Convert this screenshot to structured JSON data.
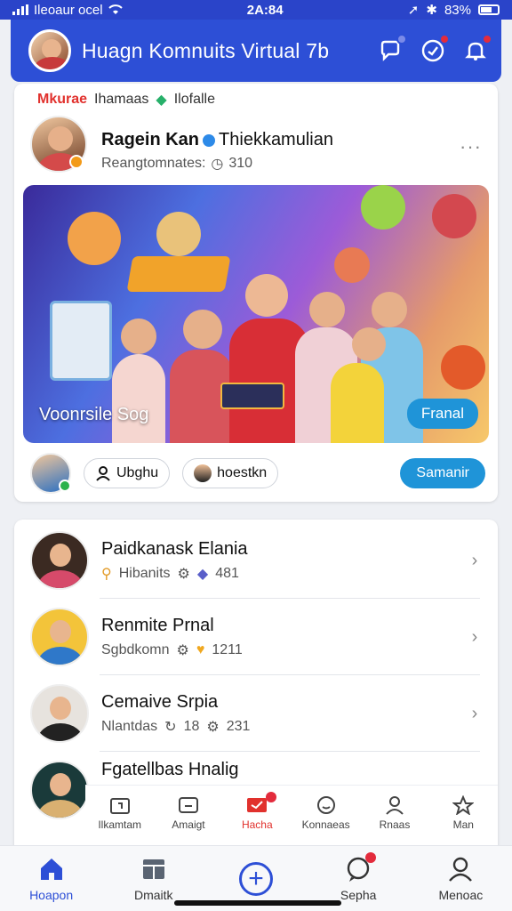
{
  "status_bar": {
    "carrier": "Ileoaur ocel",
    "time": "2A:84",
    "battery": "83%"
  },
  "header": {
    "title": "Huagn Komnuits Virtual 7b"
  },
  "post": {
    "tag_red": "Mkurae",
    "tag_gray": "Ihamaas",
    "tag_green": "Ilofalle",
    "author_name": "Ragein Kan",
    "author_handle": "Thiekkamulian",
    "author_sub": "Reangtomnates:",
    "author_sub_count": "310",
    "media_caption": "Voonrsile Sog",
    "media_button": "Franal",
    "pill_one": "Ubghu",
    "pill_two": "hoestkn",
    "submit": "Samanir"
  },
  "list": [
    {
      "title": "Paidkanask Elania",
      "sub_label": "Hibanits",
      "sub_count": "481"
    },
    {
      "title": "Renmite Prnal",
      "sub_label": "Sgbdkomn",
      "sub_count": "1211"
    },
    {
      "title": "Cemaive Srpia",
      "sub_label": "Nlantdas",
      "sub_count_a": "18",
      "sub_count": "231"
    },
    {
      "title": "Fgatellbas Hnalig"
    }
  ],
  "inner_tabs": [
    {
      "label": "Ilkamtam",
      "icon": "calendar-icon"
    },
    {
      "label": "Amaigt",
      "icon": "message-icon"
    },
    {
      "label": "Hacha",
      "icon": "ticket-icon",
      "active": true,
      "badge": true
    },
    {
      "label": "Konnaeas",
      "icon": "smile-icon"
    },
    {
      "label": "Rnaas",
      "icon": "person-icon"
    },
    {
      "label": "Man",
      "icon": "star-icon"
    }
  ],
  "bottom_nav": [
    {
      "label": "Hoapon",
      "icon": "home-icon",
      "active": true
    },
    {
      "label": "Dmaitk",
      "icon": "store-icon"
    },
    {
      "label": "",
      "icon": "plus-icon"
    },
    {
      "label": "Sepha",
      "icon": "chat-icon",
      "badge": true
    },
    {
      "label": "Menoac",
      "icon": "profile-icon"
    }
  ],
  "colors": {
    "primary": "#2d4fd6",
    "accent": "#1f94d8",
    "badge": "#e32b3c"
  }
}
